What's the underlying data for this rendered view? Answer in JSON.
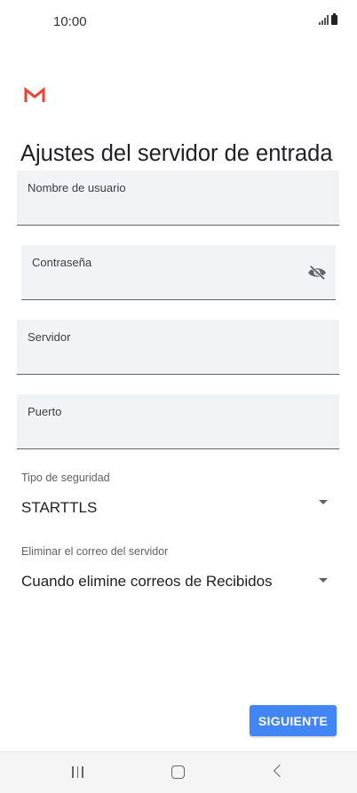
{
  "status_bar": {
    "time": "10:00"
  },
  "header": {
    "title": "Ajustes del servidor de entrada",
    "logo": "gmail-logo-icon"
  },
  "fields": {
    "username": {
      "label": "Nombre de usuario",
      "value": ""
    },
    "password": {
      "label": "Contraseña",
      "value": "",
      "toggle_icon": "eye-off-icon"
    },
    "server": {
      "label": "Servidor",
      "value": ""
    },
    "port": {
      "label": "Puerto",
      "value": ""
    }
  },
  "security": {
    "label": "Tipo de seguridad",
    "value": "STARTTLS"
  },
  "delete_mail": {
    "label": "Eliminar el correo del servidor",
    "value": "Cuando elimine correos de Recibidos"
  },
  "actions": {
    "next_label": "SIGUIENTE"
  },
  "colors": {
    "accent": "#4285f4",
    "gmail_red": "#ea4335",
    "field_bg": "#f1f3f4"
  },
  "nav_bar": {
    "icons": [
      "recent-apps-icon",
      "home-icon",
      "back-icon"
    ]
  }
}
